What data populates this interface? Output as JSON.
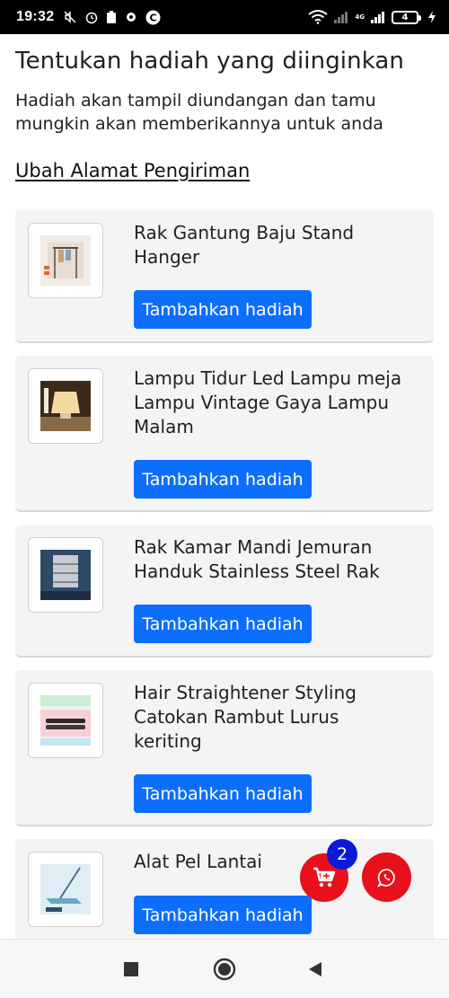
{
  "status_bar": {
    "time": "19:32",
    "network": "4G",
    "battery": "4"
  },
  "header": {
    "title": "Tentukan hadiah yang diinginkan",
    "subtitle": "Hadiah akan tampil diundangan dan tamu mungkin akan memberikannya untuk anda",
    "address_link": "Ubah Alamat Pengiriman"
  },
  "gifts": [
    {
      "name": "Rak Gantung Baju Stand Hanger",
      "button": "Tambahkan hadiah",
      "thumb_icon": "clothes-rack-product-image"
    },
    {
      "name": "Lampu Tidur Led Lampu meja Lampu Vintage Gaya Lampu Malam",
      "button": "Tambahkan hadiah",
      "thumb_icon": "table-lamp-product-image"
    },
    {
      "name": "Rak Kamar Mandi Jemuran Handuk Stainless Steel Rak",
      "button": "Tambahkan hadiah",
      "thumb_icon": "bathroom-rack-product-image"
    },
    {
      "name": "Hair Straightener Styling Catokan Rambut Lurus keriting",
      "button": "Tambahkan hadiah",
      "thumb_icon": "hair-straightener-product-image"
    },
    {
      "name": "Alat Pel Lantai",
      "button": "Tambahkan hadiah",
      "thumb_icon": "floor-mop-product-image"
    }
  ],
  "cart": {
    "count": "2",
    "icon": "cart-icon"
  },
  "whatsapp": {
    "icon": "whatsapp-icon"
  },
  "colors": {
    "primary": "#0d6efd",
    "fab": "#e8101b",
    "badge": "#0b19d8"
  }
}
